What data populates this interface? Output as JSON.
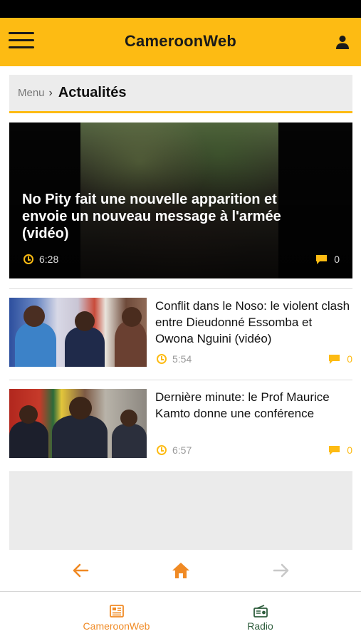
{
  "header": {
    "title": "CameroonWeb",
    "menu_icon": "hamburger-menu-icon",
    "user_icon": "user-icon",
    "bg_color": "#fdbb13"
  },
  "breadcrumb": {
    "parent": "Menu",
    "separator": "›",
    "current": "Actualités"
  },
  "featured": {
    "title": "No Pity fait une nouvelle apparition et envoie un nouveau message à l'armée (vidéo)",
    "duration": "6:28",
    "comments": "0"
  },
  "articles": [
    {
      "title": "Conflit dans le Noso: le violent clash entre Dieudonné Essomba et Owona Nguini (vidéo)",
      "duration": "5:54",
      "comments": "0"
    },
    {
      "title": "Dernière minute: le Prof Maurice Kamto donne une conférence",
      "duration": "6:57",
      "comments": "0"
    }
  ],
  "navigation": {
    "back_icon": "arrow-left-icon",
    "home_icon": "home-icon",
    "forward_icon": "arrow-right-icon",
    "accent_color": "#f08a24",
    "disabled_color": "#c8c8c8"
  },
  "tabs": [
    {
      "label": "CameroonWeb",
      "icon": "newspaper-icon",
      "color": "#f08a24"
    },
    {
      "label": "Radio",
      "icon": "radio-icon",
      "color": "#2e5d3c"
    }
  ]
}
